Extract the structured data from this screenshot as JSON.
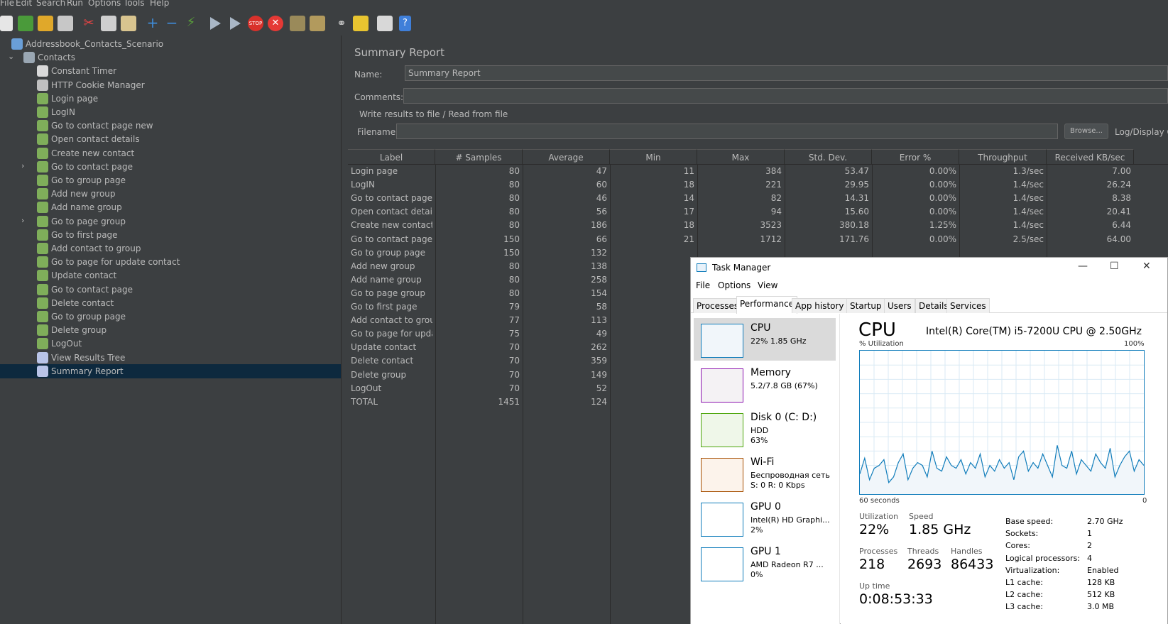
{
  "menu": [
    "File",
    "Edit",
    "Search",
    "Run",
    "Options",
    "Tools",
    "Help"
  ],
  "toolbar_icons": [
    "new-icon",
    "templates-icon",
    "open-icon",
    "save-icon",
    "cut-icon",
    "copy-icon",
    "paste-icon",
    "expand-icon",
    "collapse-icon",
    "toggle-icon",
    "start-icon",
    "start-no-pause-icon",
    "stop-icon",
    "shutdown-icon",
    "clear-icon",
    "clear-all-icon",
    "search-icon",
    "reset-search-icon",
    "function-helper-icon",
    "help-icon"
  ],
  "tree": {
    "root": "Addressbook_Contacts_Scenario",
    "group": "Contacts",
    "items": [
      {
        "label": "Constant Timer",
        "icon": "timer-icon",
        "expandable": false
      },
      {
        "label": "HTTP Cookie Manager",
        "icon": "cookie-manager-icon",
        "expandable": false
      },
      {
        "label": "Login  page",
        "icon": "sampler-icon",
        "expandable": false
      },
      {
        "label": "LogIN",
        "icon": "sampler-icon",
        "expandable": false
      },
      {
        "label": "Go to contact page new",
        "icon": "sampler-icon",
        "expandable": false
      },
      {
        "label": "Open contact details",
        "icon": "sampler-icon",
        "expandable": false
      },
      {
        "label": "Create new contact",
        "icon": "sampler-icon",
        "expandable": false
      },
      {
        "label": "Go to contact page",
        "icon": "sampler-icon",
        "expandable": true
      },
      {
        "label": "Go to group page",
        "icon": "sampler-icon",
        "expandable": false
      },
      {
        "label": "Add new group",
        "icon": "sampler-icon",
        "expandable": false
      },
      {
        "label": "Add name group",
        "icon": "sampler-icon",
        "expandable": false
      },
      {
        "label": "Go to page group",
        "icon": "sampler-icon",
        "expandable": true
      },
      {
        "label": "Go to first page",
        "icon": "sampler-icon",
        "expandable": false
      },
      {
        "label": "Add contact to group",
        "icon": "sampler-icon",
        "expandable": false
      },
      {
        "label": "Go to page for update contact",
        "icon": "sampler-icon",
        "expandable": false
      },
      {
        "label": "Update contact",
        "icon": "sampler-icon",
        "expandable": false
      },
      {
        "label": "Go to contact page",
        "icon": "sampler-icon",
        "expandable": false
      },
      {
        "label": "Delete contact",
        "icon": "sampler-icon",
        "expandable": false
      },
      {
        "label": "Go to group page",
        "icon": "sampler-icon",
        "expandable": false
      },
      {
        "label": "Delete group",
        "icon": "sampler-icon",
        "expandable": false
      },
      {
        "label": "LogOut",
        "icon": "sampler-icon",
        "expandable": false
      },
      {
        "label": "View Results Tree",
        "icon": "listener-icon",
        "expandable": false
      },
      {
        "label": "Summary Report",
        "icon": "listener-icon",
        "expandable": false,
        "selected": true
      }
    ]
  },
  "report": {
    "title": "Summary Report",
    "name_label": "Name:",
    "name_value": "Summary Report",
    "comments_label": "Comments:",
    "comments_value": "",
    "write_results_label": "Write results to file / Read from file",
    "filename_label": "Filename",
    "filename_value": "",
    "browse_label": "Browse...",
    "log_display_label": "Log/Display O"
  },
  "table": {
    "columns": [
      "Label",
      "# Samples",
      "Average",
      "Min",
      "Max",
      "Std. Dev.",
      "Error %",
      "Throughput",
      "Received KB/sec"
    ],
    "rows": [
      [
        "Login  page",
        "80",
        "47",
        "11",
        "384",
        "53.47",
        "0.00%",
        "1.3/sec",
        "7.00"
      ],
      [
        "LogIN",
        "80",
        "60",
        "18",
        "221",
        "29.95",
        "0.00%",
        "1.4/sec",
        "26.24"
      ],
      [
        "Go to contact page ...",
        "80",
        "46",
        "14",
        "82",
        "14.31",
        "0.00%",
        "1.4/sec",
        "8.38"
      ],
      [
        "Open contact details",
        "80",
        "56",
        "17",
        "94",
        "15.60",
        "0.00%",
        "1.4/sec",
        "20.41"
      ],
      [
        "Create new contact",
        "80",
        "186",
        "18",
        "3523",
        "380.18",
        "1.25%",
        "1.4/sec",
        "6.44"
      ],
      [
        "Go to contact page",
        "150",
        "66",
        "21",
        "1712",
        "171.76",
        "0.00%",
        "2.5/sec",
        "64.00"
      ],
      [
        "Go to group page",
        "150",
        "132",
        "",
        "",
        "",
        "",
        "",
        ""
      ],
      [
        "Add new group",
        "80",
        "138",
        "",
        "",
        "",
        "",
        "",
        ""
      ],
      [
        "Add name group",
        "80",
        "258",
        "",
        "",
        "",
        "",
        "",
        ""
      ],
      [
        "Go to page group",
        "80",
        "154",
        "",
        "",
        "",
        "",
        "",
        ""
      ],
      [
        "Go to first page",
        "79",
        "58",
        "",
        "",
        "",
        "",
        "",
        ""
      ],
      [
        "Add contact to group",
        "77",
        "113",
        "",
        "",
        "",
        "",
        "",
        ""
      ],
      [
        "Go to page for upda...",
        "75",
        "49",
        "",
        "",
        "",
        "",
        "",
        ""
      ],
      [
        "Update contact",
        "70",
        "262",
        "",
        "",
        "",
        "",
        "",
        ""
      ],
      [
        "Delete contact",
        "70",
        "359",
        "",
        "",
        "",
        "",
        "",
        ""
      ],
      [
        "Delete group",
        "70",
        "149",
        "",
        "",
        "",
        "",
        "",
        ""
      ],
      [
        "LogOut",
        "70",
        "52",
        "",
        "",
        "",
        "",
        "",
        ""
      ],
      [
        "TOTAL",
        "1451",
        "124",
        "",
        "",
        "",
        "",
        "",
        ""
      ]
    ]
  },
  "task_manager": {
    "title": "Task Manager",
    "menu": [
      "File",
      "Options",
      "View"
    ],
    "tabs": [
      "Processes",
      "Performance",
      "App history",
      "Startup",
      "Users",
      "Details",
      "Services"
    ],
    "active_tab": "Performance",
    "side_items": [
      {
        "name": "CPU",
        "line1": "22%  1.85 GHz",
        "line2": "",
        "color": "#117dbb",
        "fill": "#f1f6fa"
      },
      {
        "name": "Memory",
        "line1": "5.2/7.8 GB (67%)",
        "line2": "",
        "color": "#8b12ae",
        "fill": "#f4f2f4"
      },
      {
        "name": "Disk 0 (C: D:)",
        "line1": "HDD",
        "line2": "63%",
        "color": "#4da60c",
        "fill": "#eff7e9"
      },
      {
        "name": "Wi-Fi",
        "line1": "Беспроводная сеть",
        "line2": "S: 0  R: 0 Kbps",
        "color": "#a74f01",
        "fill": "#fcf3eb"
      },
      {
        "name": "GPU 0",
        "line1": "Intel(R) HD Graphi...",
        "line2": "2%",
        "color": "#117dbb",
        "fill": "#ffffff"
      },
      {
        "name": "GPU 1",
        "line1": "AMD Radeon R7 ...",
        "line2": "0%",
        "color": "#117dbb",
        "fill": "#ffffff"
      }
    ],
    "cpu": {
      "title": "CPU",
      "model": "Intel(R) Core(TM) i5-7200U CPU @ 2.50GHz",
      "util_label": "% Utilization",
      "max_label": "100%",
      "time_label": "60 seconds",
      "zero_label": "0",
      "utilization_label": "Utilization",
      "utilization": "22%",
      "speed_label": "Speed",
      "speed": "1.85 GHz",
      "processes_label": "Processes",
      "processes": "218",
      "threads_label": "Threads",
      "threads": "2693",
      "handles_label": "Handles",
      "handles": "86433",
      "uptime_label": "Up time",
      "uptime": "0:08:53:33",
      "specs": [
        [
          "Base speed:",
          "2.70 GHz"
        ],
        [
          "Sockets:",
          "1"
        ],
        [
          "Cores:",
          "2"
        ],
        [
          "Logical processors:",
          "4"
        ],
        [
          "Virtualization:",
          "Enabled"
        ],
        [
          "L1 cache:",
          "128 KB"
        ],
        [
          "L2 cache:",
          "512 KB"
        ],
        [
          "L3 cache:",
          "3.0 MB"
        ]
      ],
      "history": [
        14,
        25,
        10,
        18,
        20,
        24,
        8,
        12,
        22,
        28,
        10,
        18,
        22,
        20,
        12,
        30,
        18,
        16,
        26,
        20,
        18,
        24,
        14,
        22,
        18,
        28,
        12,
        20,
        16,
        24,
        18,
        22,
        10,
        26,
        30,
        16,
        22,
        18,
        28,
        20,
        12,
        34,
        20,
        18,
        30,
        14,
        24,
        20,
        16,
        28,
        22,
        18,
        32,
        12,
        20,
        26,
        30,
        16,
        24,
        20
      ]
    }
  },
  "colors": {
    "background": "#3c3f41",
    "selected_row": "#0d293e",
    "accent": "#117dbb"
  }
}
